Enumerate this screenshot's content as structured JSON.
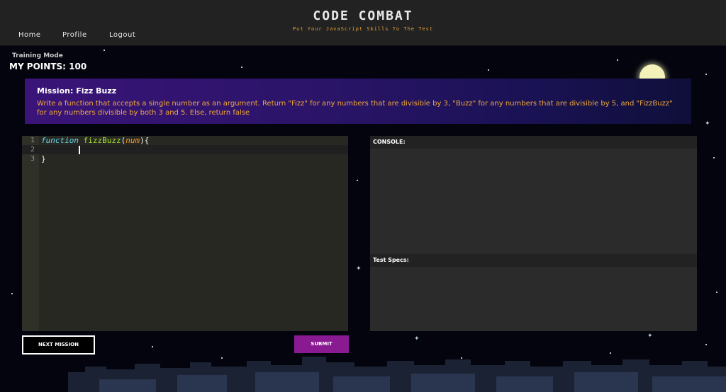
{
  "header": {
    "title": "CODE COMBAT",
    "tagline": "Put Your JavaScript Skills To The Test",
    "nav": [
      {
        "label": "Home"
      },
      {
        "label": "Profile"
      },
      {
        "label": "Logout"
      }
    ]
  },
  "status": {
    "mode": "Training Mode",
    "points": "MY POINTS: 100"
  },
  "mission": {
    "title": "Mission: Fizz Buzz",
    "description": "Write a function that accepts a single number as an argument. Return \"Fizz\" for any numbers that are divisible by 3, \"Buzz\" for any numbers that are divisible by 5, and \"FizzBuzz\" for any numbers divisible by both 3 and 5. Else, return false"
  },
  "editor": {
    "lines": [
      {
        "number": "1",
        "keyword": "function",
        "name": "fizzBuzz",
        "open": "(",
        "param": "num",
        "close": "){"
      },
      {
        "number": "2"
      },
      {
        "number": "3",
        "text": "}"
      }
    ]
  },
  "console": {
    "console_label": "CONSOLE:",
    "specs_label": "Test Specs:"
  },
  "buttons": {
    "next_label": "NEXT MISSION",
    "submit_label": "SUBMIT"
  },
  "colors": {
    "accent": "#8a1a92",
    "tagline": "#e3a33a",
    "mission_text": "#f0a83a"
  },
  "icons": {
    "moon": "moon-icon",
    "clouds": "clouds-decoration"
  }
}
